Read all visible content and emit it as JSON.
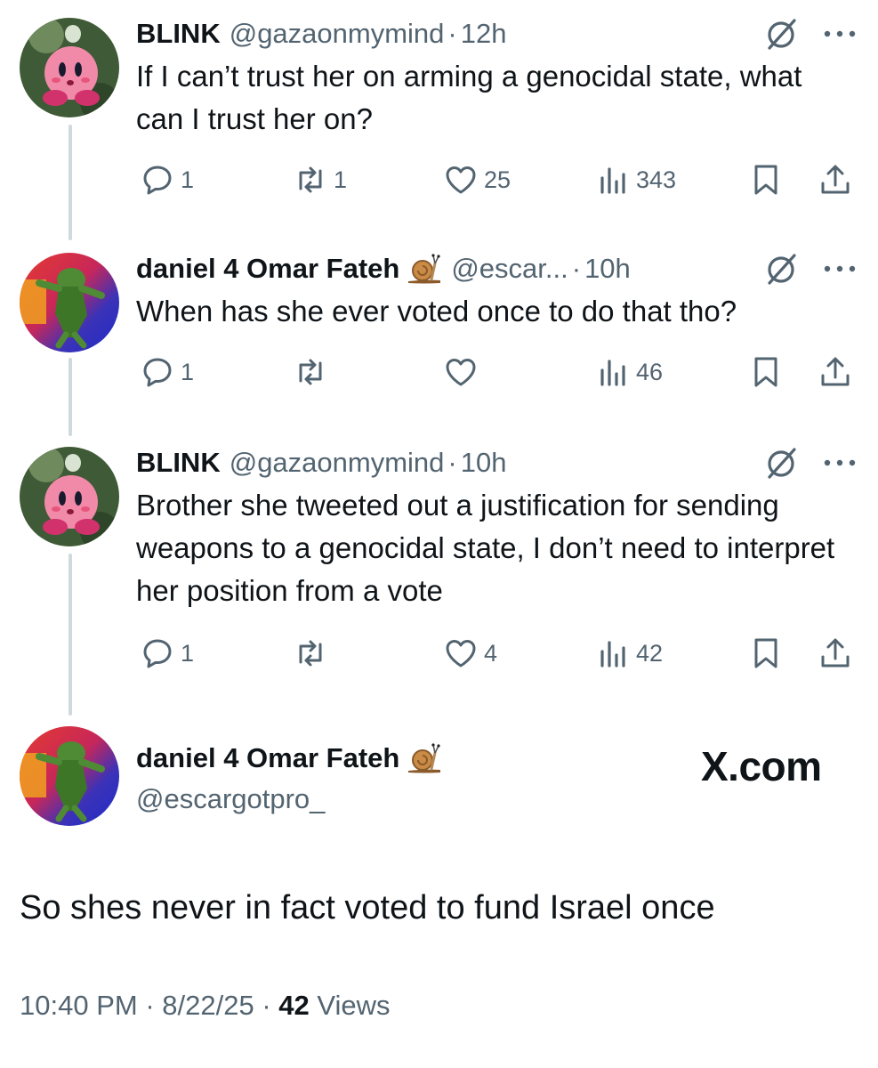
{
  "thread": [
    {
      "name": "BLINK",
      "handle": "@gazaonmymind",
      "dot": "·",
      "time": "12h",
      "text": "If I can’t trust her on arming a genocidal state, what can I trust her on?",
      "replies": "1",
      "reposts": "1",
      "likes": "25",
      "views": "343",
      "avatar": "kirby-avatar"
    },
    {
      "name": "daniel 4 Omar Fateh",
      "emoji": "snail-emoji",
      "handle": "@escar...",
      "dot": "·",
      "time": "10h",
      "text": "When has she ever voted once to do that tho?",
      "replies": "1",
      "reposts": "",
      "likes": "",
      "views": "46",
      "avatar": "frog-avatar"
    },
    {
      "name": "BLINK",
      "handle": "@gazaonmymind",
      "dot": "·",
      "time": "10h",
      "text": "Brother she tweeted out a justification for sending weapons to a genocidal state, I don’t need to interpret her position from a vote",
      "replies": "1",
      "reposts": "",
      "likes": "4",
      "views": "42",
      "avatar": "kirby-avatar"
    }
  ],
  "main_tweet": {
    "name": "daniel 4 Omar Fateh",
    "emoji": "snail-emoji",
    "handle": "@escargotpro_",
    "text": "So shes never in fact voted to fund Israel once",
    "time": "10:40 PM",
    "date": "8/22/25",
    "views_count": "42",
    "views_label": "Views",
    "separator": "·"
  },
  "watermark": "X.com",
  "colors": {
    "text_primary": "#0f1419",
    "text_secondary": "#536471",
    "thread_line": "#cfd9de"
  }
}
